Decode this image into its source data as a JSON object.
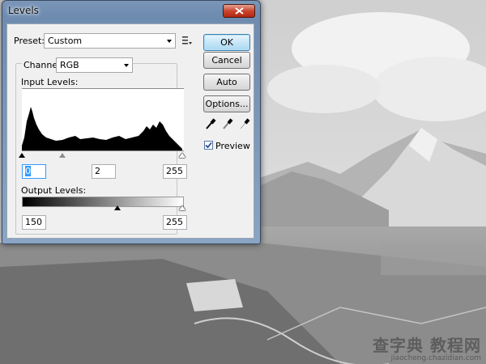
{
  "dialog": {
    "title": "Levels",
    "preset": {
      "label": "Preset:",
      "value": "Custom"
    },
    "channel": {
      "label": "Channel:",
      "value": "RGB"
    },
    "input_levels": {
      "label": "Input Levels:",
      "shadow": "0",
      "midtone": "2",
      "highlight": "255"
    },
    "output_levels": {
      "label": "Output Levels:",
      "shadow": "150",
      "highlight": "255"
    },
    "buttons": {
      "ok": "OK",
      "cancel": "Cancel",
      "auto": "Auto",
      "options": "Options..."
    },
    "preview": {
      "label": "Preview",
      "checked": true
    }
  },
  "watermark": {
    "main": "查字典 教程网",
    "sub": "jiaocheng.chazidian.com"
  },
  "icons": {
    "close": "close-icon",
    "preset_menu": "menu-options-icon",
    "dropdown": "chevron-down-icon",
    "eyedroppers": [
      "black-eyedropper-icon",
      "gray-eyedropper-icon",
      "white-eyedropper-icon"
    ]
  },
  "colors": {
    "title_accent": "#6e8cb0",
    "close": "#c9462f",
    "focus": "#3399ff"
  }
}
